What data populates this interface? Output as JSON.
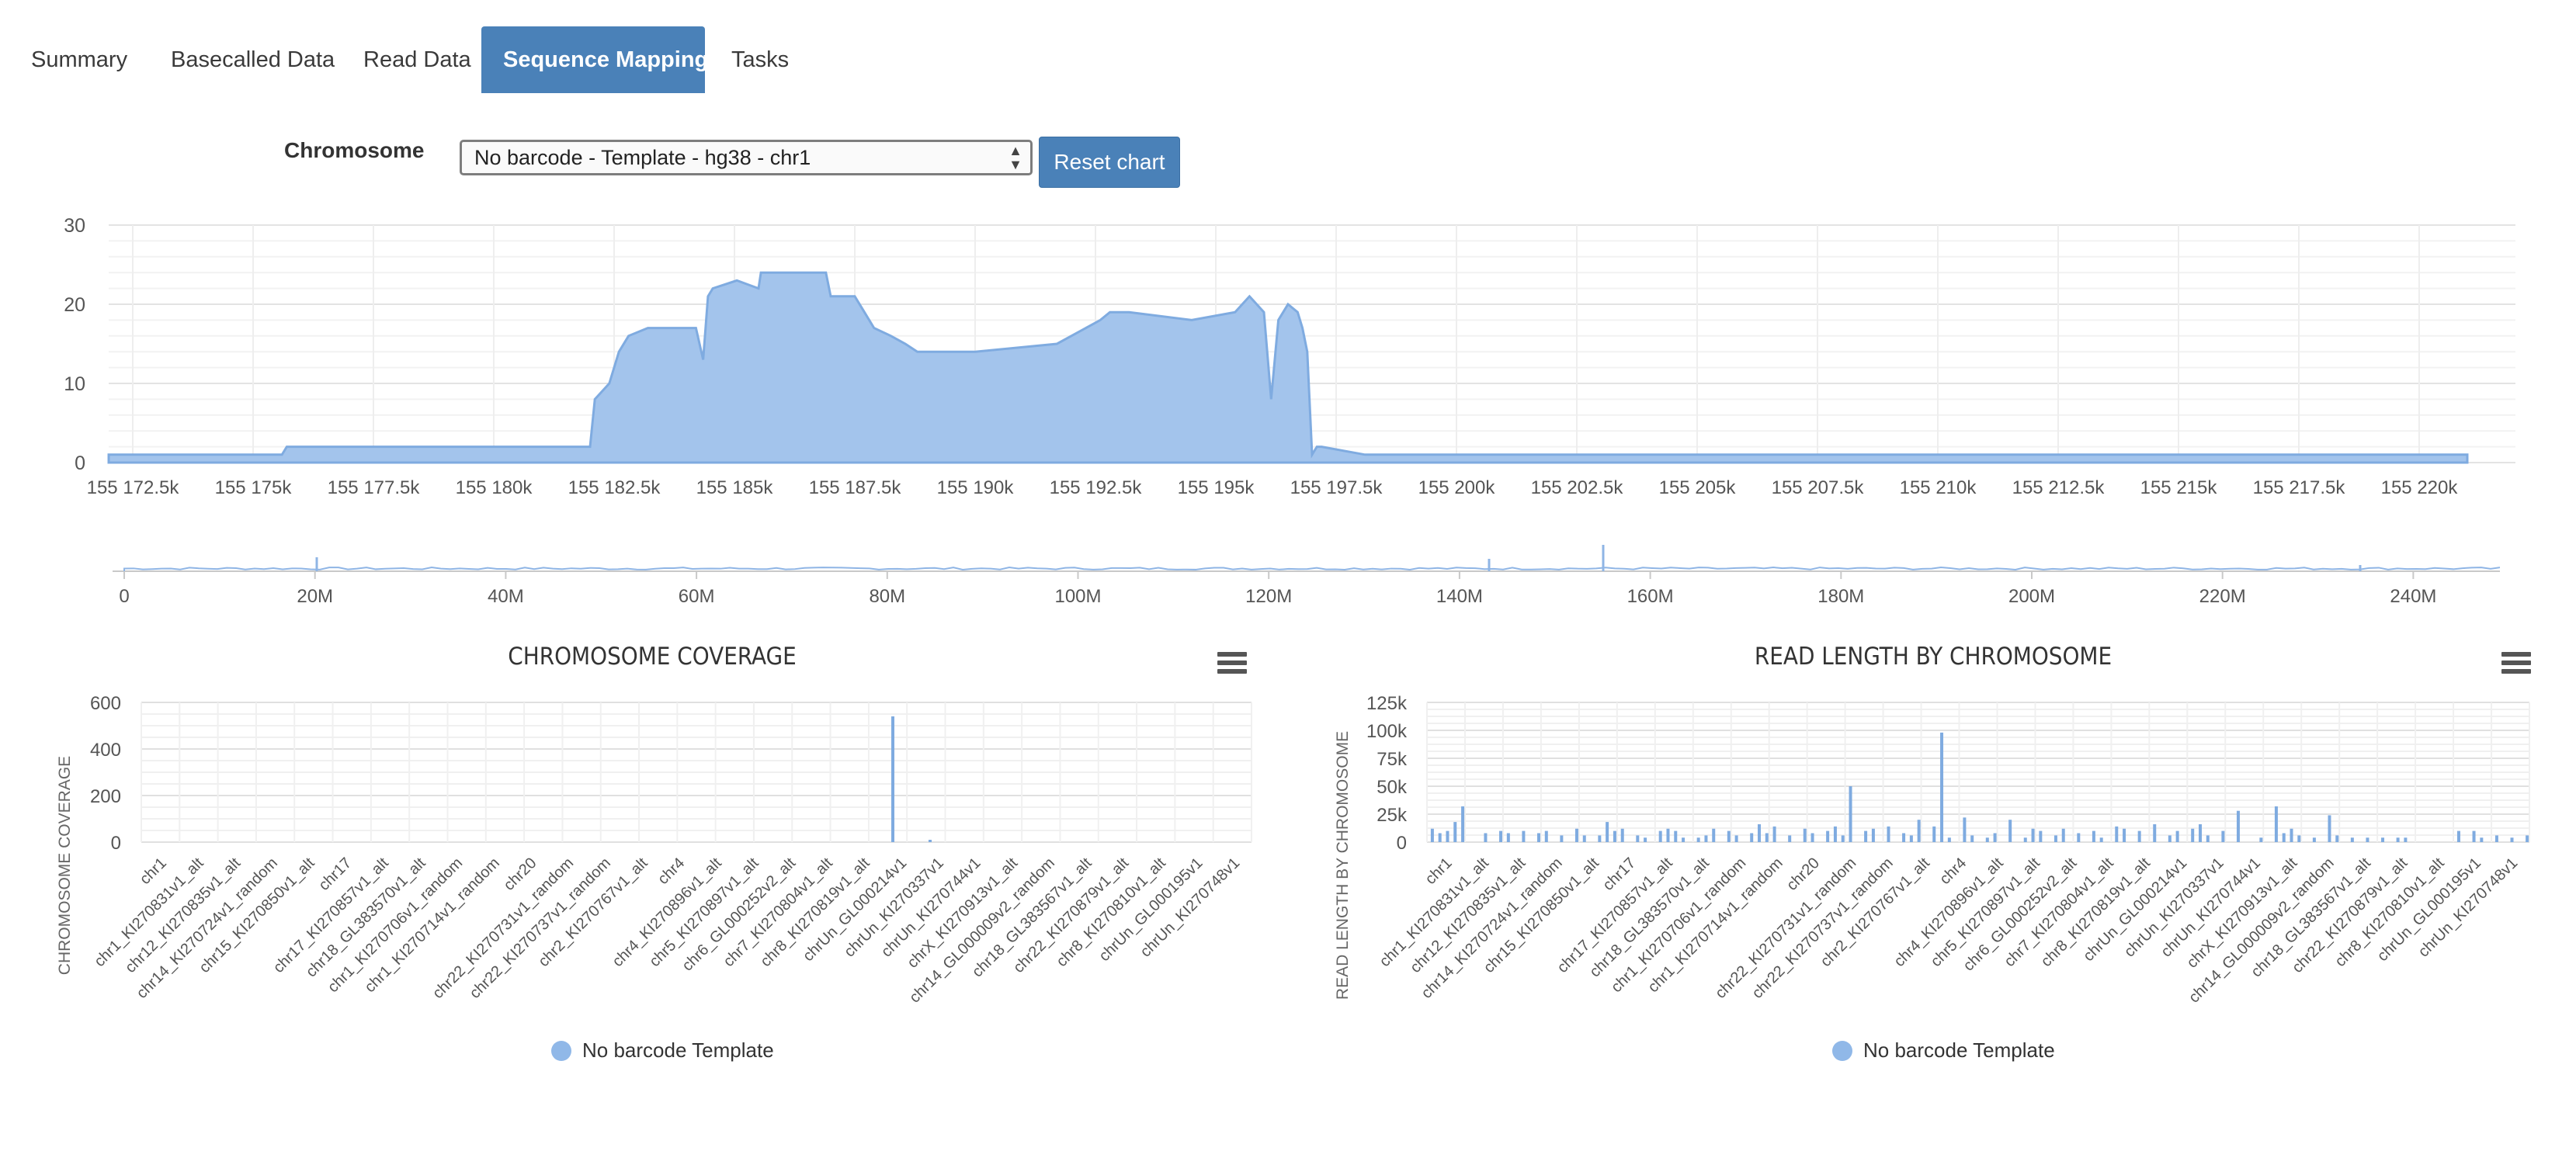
{
  "tabs": [
    {
      "label": "Summary",
      "active": false
    },
    {
      "label": "Basecalled Data",
      "active": false
    },
    {
      "label": "Read Data",
      "active": false
    },
    {
      "label": "Sequence Mapping",
      "active": true
    },
    {
      "label": "Tasks",
      "active": false
    }
  ],
  "controls": {
    "chromosome_label": "Chromosome",
    "chromosome_selected": "No barcode - Template - hg38 - chr1",
    "reset_label": "Reset chart"
  },
  "colors": {
    "accent": "#4a81b8",
    "series_fill": "#a3c4ec",
    "series_line": "#7fabe0",
    "legend_dot": "#90b8e8",
    "grid": "#e6e6e6"
  },
  "chart_data": [
    {
      "type": "area",
      "ylim": [
        0,
        30
      ],
      "yticks": [
        "0",
        "10",
        "20",
        "30"
      ],
      "xticks": [
        "155 172.5k",
        "155 175k",
        "155 177.5k",
        "155 180k",
        "155 182.5k",
        "155 185k",
        "155 187.5k",
        "155 190k",
        "155 192.5k",
        "155 195k",
        "155 197.5k",
        "155 200k",
        "155 202.5k",
        "155 205k",
        "155 207.5k",
        "155 210k",
        "155 212.5k",
        "155 215k",
        "155 217.5k",
        "155 220k"
      ],
      "x": [
        155172000,
        155175600,
        155175700,
        155182000,
        155182100,
        155182400,
        155182600,
        155182800,
        155183200,
        155184200,
        155184350,
        155184450,
        155184550,
        155185050,
        155185500,
        155185550,
        155186900,
        155187000,
        155187500,
        155187700,
        155187900,
        155188250,
        155188550,
        155188800,
        155190000,
        155191700,
        155192600,
        155192800,
        155193200,
        155194500,
        155195400,
        155195700,
        155196000,
        155196150,
        155196300,
        155196400,
        155196500,
        155196700,
        155196800,
        155196900,
        155197000,
        155197100,
        155197200,
        155198100,
        155221000
      ],
      "series": [
        {
          "values": [
            1,
            1,
            2,
            2,
            8,
            10,
            14,
            16,
            17,
            17,
            13,
            21,
            22,
            23,
            22,
            24,
            24,
            21,
            21,
            19,
            17,
            16,
            15,
            14,
            14,
            15,
            18,
            19,
            19,
            18,
            19,
            21,
            19,
            8,
            18,
            19,
            20,
            19,
            17,
            14,
            1,
            2,
            2,
            1,
            1
          ]
        }
      ]
    },
    {
      "type": "area",
      "xticks": [
        "0",
        "20M",
        "40M",
        "60M",
        "80M",
        "100M",
        "120M",
        "140M",
        "160M",
        "180M",
        "200M",
        "220M",
        "240M"
      ]
    },
    {
      "type": "bar",
      "title": "CHROMOSOME COVERAGE",
      "ylabel": "CHROMOSOME COVERAGE",
      "ylim": [
        0,
        600
      ],
      "yticks": [
        "0",
        "200",
        "400",
        "600"
      ],
      "categories": [
        "chr1",
        "chr1_KI270831v1_alt",
        "chr12_KI270835v1_alt",
        "chr14_KI270724v1_random",
        "chr15_KI270850v1_alt",
        "chr17",
        "chr17_KI270857v1_alt",
        "chr18_GL383570v1_alt",
        "chr1_KI270706v1_random",
        "chr1_KI270714v1_random",
        "chr20",
        "chr22_KI270731v1_random",
        "chr22_KI270737v1_random",
        "chr2_KI270767v1_alt",
        "chr4",
        "chr4_KI270896v1_alt",
        "chr5_KI270897v1_alt",
        "chr6_GL000252v2_alt",
        "chr7_KI270804v1_alt",
        "chr8_KI270819v1_alt",
        "chrUn_GL000214v1",
        "chrUn_KI270337v1",
        "chrUn_KI270744v1",
        "chrX_KI270913v1_alt",
        "chr14_GL000009v2_random",
        "chr18_GL383567v1_alt",
        "chr22_KI270879v1_alt",
        "chr8_KI270810v1_alt",
        "chrUn_GL000195v1",
        "chrUn_KI270748v1"
      ],
      "values": [
        540,
        10
      ],
      "series": [
        {
          "name": "No barcode Template"
        }
      ]
    },
    {
      "type": "bar",
      "title": "READ LENGTH BY CHROMOSOME",
      "ylabel": "READ LENGTH BY CHROMOSOME",
      "ylim": [
        0,
        125000
      ],
      "yticks": [
        "0",
        "25k",
        "50k",
        "75k",
        "100k",
        "125k"
      ],
      "categories": [
        "chr1",
        "chr1_KI270831v1_alt",
        "chr12_KI270835v1_alt",
        "chr14_KI270724v1_random",
        "chr15_KI270850v1_alt",
        "chr17",
        "chr17_KI270857v1_alt",
        "chr18_GL383570v1_alt",
        "chr1_KI270706v1_random",
        "chr1_KI270714v1_random",
        "chr20",
        "chr22_KI270731v1_random",
        "chr22_KI270737v1_random",
        "chr2_KI270767v1_alt",
        "chr4",
        "chr4_KI270896v1_alt",
        "chr5_KI270897v1_alt",
        "chr6_GL000252v2_alt",
        "chr7_KI270804v1_alt",
        "chr8_KI270819v1_alt",
        "chrUn_GL000214v1",
        "chrUn_KI270337v1",
        "chrUn_KI270744v1",
        "chrX_KI270913v1_alt",
        "chr14_GL000009v2_random",
        "chr18_GL383567v1_alt",
        "chr22_KI270879v1_alt",
        "chr8_KI270810v1_alt",
        "chrUn_GL000195v1",
        "chrUn_KI270748v1"
      ],
      "values": [
        12000,
        8000,
        10000,
        18000,
        32000,
        0,
        0,
        8000,
        0,
        10000,
        8000,
        0,
        10000,
        0,
        8000,
        10000,
        0,
        6000,
        0,
        12000,
        6000,
        0,
        6000,
        18000,
        10000,
        12000,
        0,
        6000,
        4000,
        0,
        10000,
        12000,
        10000,
        4000,
        0,
        4000,
        6000,
        12000,
        0,
        10000,
        6000,
        0,
        8000,
        16000,
        8000,
        14000,
        0,
        6000,
        0,
        12000,
        8000,
        0,
        10000,
        14000,
        6000,
        50000,
        0,
        10000,
        12000,
        0,
        14000,
        0,
        8000,
        6000,
        20000,
        0,
        14000,
        98000,
        4000,
        0,
        22000,
        6000,
        0,
        4000,
        8000,
        0,
        20000,
        0,
        4000,
        12000,
        10000,
        0,
        6000,
        12000,
        0,
        8000,
        0,
        10000,
        4000,
        0,
        14000,
        12000,
        0,
        10000,
        0,
        16000,
        0,
        6000,
        10000,
        0,
        12000,
        16000,
        6000,
        0,
        10000,
        0,
        28000,
        0,
        0,
        4000,
        0,
        32000,
        8000,
        12000,
        6000,
        0,
        4000,
        0,
        24000,
        6000,
        0,
        4000,
        0,
        4000,
        0,
        4000,
        0,
        4000,
        4000,
        0,
        0,
        0,
        0,
        0,
        0,
        10000,
        0,
        10000,
        4000,
        0,
        6000,
        0,
        4000,
        0,
        6000
      ],
      "series": [
        {
          "name": "No barcode Template"
        }
      ]
    }
  ]
}
